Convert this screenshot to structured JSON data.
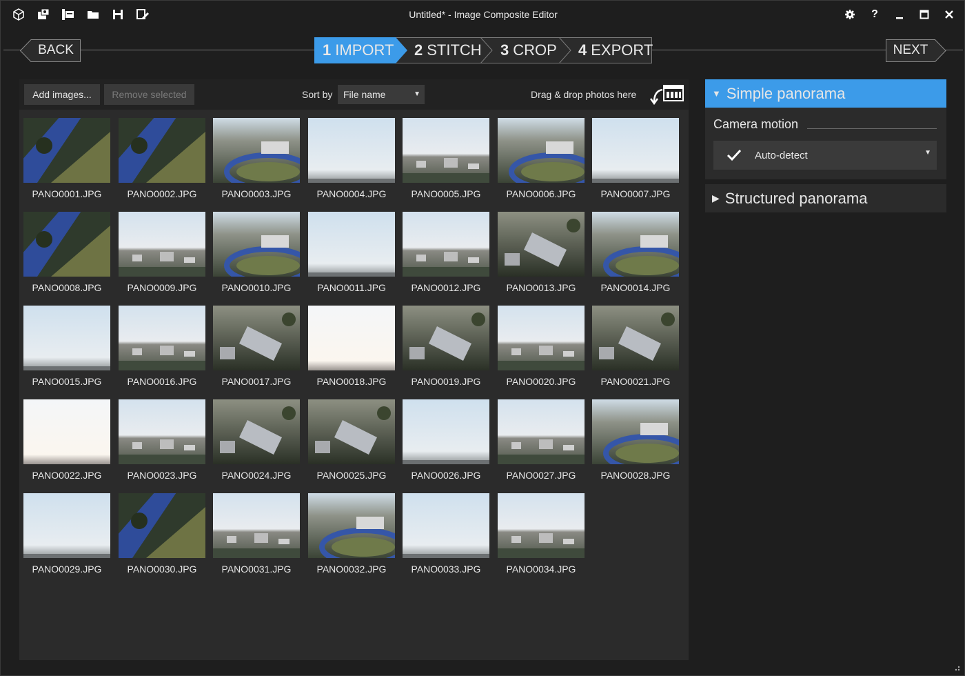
{
  "window": {
    "title": "Untitled* - Image Composite Editor"
  },
  "titlebar": {
    "tools": [
      {
        "icon": "cube-icon",
        "name": "new-project"
      },
      {
        "icon": "import-photos-icon",
        "name": "new-panorama-from-images"
      },
      {
        "icon": "import-video-icon",
        "name": "new-panorama-from-video"
      },
      {
        "icon": "folder-icon",
        "name": "open-project"
      },
      {
        "icon": "save-icon",
        "name": "save-project"
      },
      {
        "icon": "save-as-icon",
        "name": "save-project-as"
      }
    ],
    "controls": [
      {
        "icon": "gear-icon",
        "name": "settings"
      },
      {
        "icon": "help-icon",
        "name": "help",
        "glyph": "?"
      },
      {
        "icon": "minimize-icon",
        "name": "minimize"
      },
      {
        "icon": "maximize-icon",
        "name": "maximize"
      },
      {
        "icon": "close-icon",
        "name": "close"
      }
    ]
  },
  "wizard": {
    "back_label": "BACK",
    "next_label": "NEXT",
    "steps": [
      {
        "num": "1",
        "label": "IMPORT",
        "active": true
      },
      {
        "num": "2",
        "label": "STITCH",
        "active": false
      },
      {
        "num": "3",
        "label": "CROP",
        "active": false
      },
      {
        "num": "4",
        "label": "EXPORT",
        "active": false
      }
    ],
    "active_color": "#3c9be9"
  },
  "toolbar": {
    "add_label": "Add images...",
    "remove_label": "Remove selected",
    "sort_label": "Sort by",
    "sort_value": "File name",
    "drag_label": "Drag & drop photos here"
  },
  "images": [
    {
      "name": "PANO0001.JPG",
      "kind": "aerial"
    },
    {
      "name": "PANO0002.JPG",
      "kind": "aerial"
    },
    {
      "name": "PANO0003.JPG",
      "kind": "track"
    },
    {
      "name": "PANO0004.JPG",
      "kind": "sky"
    },
    {
      "name": "PANO0005.JPG",
      "kind": "city"
    },
    {
      "name": "PANO0006.JPG",
      "kind": "track"
    },
    {
      "name": "PANO0007.JPG",
      "kind": "sky"
    },
    {
      "name": "PANO0008.JPG",
      "kind": "aerial"
    },
    {
      "name": "PANO0009.JPG",
      "kind": "city"
    },
    {
      "name": "PANO0010.JPG",
      "kind": "track"
    },
    {
      "name": "PANO0011.JPG",
      "kind": "sky"
    },
    {
      "name": "PANO0012.JPG",
      "kind": "city"
    },
    {
      "name": "PANO0013.JPG",
      "kind": "dark"
    },
    {
      "name": "PANO0014.JPG",
      "kind": "track"
    },
    {
      "name": "PANO0015.JPG",
      "kind": "sky"
    },
    {
      "name": "PANO0016.JPG",
      "kind": "city"
    },
    {
      "name": "PANO0017.JPG",
      "kind": "dark"
    },
    {
      "name": "PANO0018.JPG",
      "kind": "bright"
    },
    {
      "name": "PANO0019.JPG",
      "kind": "dark"
    },
    {
      "name": "PANO0020.JPG",
      "kind": "city"
    },
    {
      "name": "PANO0021.JPG",
      "kind": "dark"
    },
    {
      "name": "PANO0022.JPG",
      "kind": "bright"
    },
    {
      "name": "PANO0023.JPG",
      "kind": "city"
    },
    {
      "name": "PANO0024.JPG",
      "kind": "dark"
    },
    {
      "name": "PANO0025.JPG",
      "kind": "dark"
    },
    {
      "name": "PANO0026.JPG",
      "kind": "sky"
    },
    {
      "name": "PANO0027.JPG",
      "kind": "city"
    },
    {
      "name": "PANO0028.JPG",
      "kind": "track"
    },
    {
      "name": "PANO0029.JPG",
      "kind": "sky"
    },
    {
      "name": "PANO0030.JPG",
      "kind": "aerial"
    },
    {
      "name": "PANO0031.JPG",
      "kind": "city"
    },
    {
      "name": "PANO0032.JPG",
      "kind": "track"
    },
    {
      "name": "PANO0033.JPG",
      "kind": "sky"
    },
    {
      "name": "PANO0034.JPG",
      "kind": "city"
    }
  ],
  "panel": {
    "simple_label": "Simple panorama",
    "camera_motion_label": "Camera motion",
    "camera_motion_value": "Auto-detect",
    "structured_label": "Structured panorama",
    "accent_color": "#3c9be9"
  }
}
